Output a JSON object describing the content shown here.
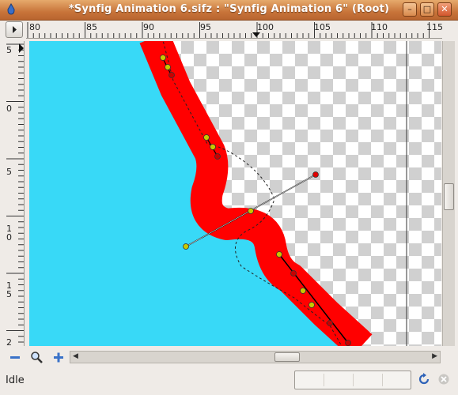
{
  "window": {
    "title": "*Synfig Animation 6.sifz : \"Synfig Animation 6\" (Root)",
    "minimize_label": "–",
    "maximize_label": "□",
    "close_label": "✕"
  },
  "rulers": {
    "horizontal_labels": [
      "80",
      "85",
      "90",
      "95",
      "100",
      "105",
      "110",
      "115"
    ],
    "vertical_labels": [
      "5",
      "0",
      "5",
      "1\n0",
      "1\n5",
      "2"
    ]
  },
  "toolbar": {
    "zoom_out_icon": "minus-icon",
    "zoom_fit_icon": "magnifier-icon",
    "zoom_in_icon": "plus-icon"
  },
  "status": {
    "text": "Idle",
    "refresh_icon": "refresh-icon",
    "stop_icon": "stop-icon"
  },
  "colors": {
    "fill": "#38d9f7",
    "outline": "#ff0000",
    "handle_yellow": "#c8c800",
    "handle_red": "#e00000",
    "checker_light": "#ffffff",
    "checker_dark": "#d0d0d0",
    "title_bar": "#d6874a"
  }
}
